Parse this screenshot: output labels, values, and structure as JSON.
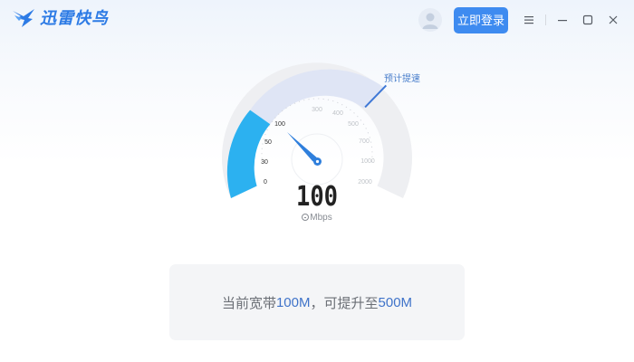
{
  "app": {
    "logo_text": "迅雷快鸟",
    "brand_color": "#2d7be5"
  },
  "header": {
    "avatar_icon": "user-avatar-icon",
    "login_label": "立即登录",
    "menu_icon": "hamburger-menu-icon",
    "minimize_icon": "minimize-icon",
    "maximize_icon": "maximize-icon",
    "close_icon": "close-icon"
  },
  "gauge": {
    "hint_label": "预计提速",
    "ticks": [
      "0",
      "30",
      "50",
      "100",
      "300",
      "400",
      "500",
      "700",
      "1000",
      "2000"
    ],
    "current_speed": "100",
    "unit": "Mbps",
    "current_value": 100,
    "boost_value": 500,
    "colors": {
      "active": "#2cb1f0",
      "boost": "#dfe5f5",
      "track": "#eeeff2",
      "needle": "#2f7fdc"
    }
  },
  "info": {
    "prefix": "当前宽带",
    "current": "100M",
    "middle": "，可提升至",
    "target": "500M"
  }
}
